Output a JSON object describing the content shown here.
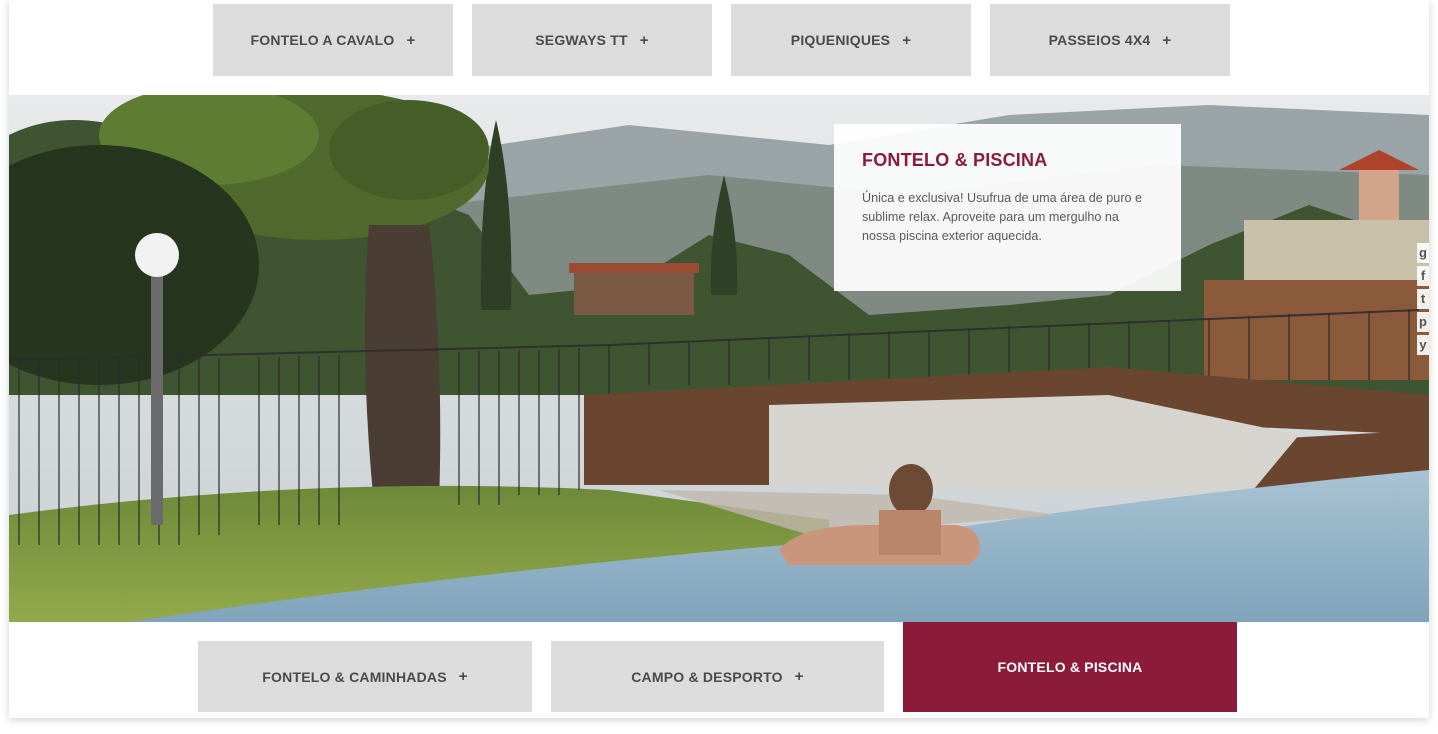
{
  "top_tabs": [
    {
      "label": "FONTELO A CAVALO",
      "plus": "+"
    },
    {
      "label": "SEGWAYS TT",
      "plus": "+"
    },
    {
      "label": "PIQUENIQUES",
      "plus": "+"
    },
    {
      "label": "PASSEIOS 4X4",
      "plus": "+"
    }
  ],
  "info": {
    "title": "FONTELO & PISCINA",
    "text": "Única e exclusiva! Usufrua de uma área de puro e sublime relax. Aproveite para um mergulho na nossa piscina exterior aquecida."
  },
  "social": [
    "g",
    "f",
    "t",
    "p",
    "y"
  ],
  "bottom_tabs": [
    {
      "label": "FONTELO & CAMINHADAS",
      "plus": "+"
    },
    {
      "label": "CAMPO & DESPORTO",
      "plus": "+"
    },
    {
      "label": "FONTELO & PISCINA",
      "plus": ""
    }
  ],
  "colors": {
    "accent": "#8c1a39",
    "tab_bg": "#dcdcdc",
    "tab_text": "#4a4a4a"
  }
}
